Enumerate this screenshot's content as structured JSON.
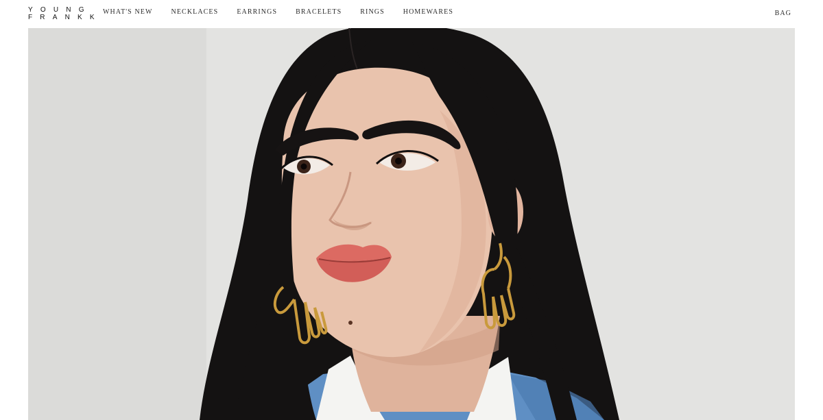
{
  "brand": {
    "line1": "YOUNG",
    "line2": "FRANKK"
  },
  "nav": {
    "items": [
      {
        "label": "WHAT'S NEW",
        "id": "whats-new"
      },
      {
        "label": "NECKLACES",
        "id": "necklaces"
      },
      {
        "label": "EARRINGS",
        "id": "earrings"
      },
      {
        "label": "BRACELETS",
        "id": "bracelets"
      },
      {
        "label": "RINGS",
        "id": "rings"
      },
      {
        "label": "HOMEWARES",
        "id": "homewares"
      }
    ],
    "bag_label": "BAG"
  },
  "hero": {
    "image_subject": "portrait-model-gold-earrings",
    "colors": {
      "background": "#e3e3e1",
      "hair": "#141212",
      "skin": "#e9c3ad",
      "lips": "#dc6a62",
      "gold": "#c99a3c",
      "denim": "#5f8fc4",
      "collar": "#f4f4f2"
    }
  }
}
